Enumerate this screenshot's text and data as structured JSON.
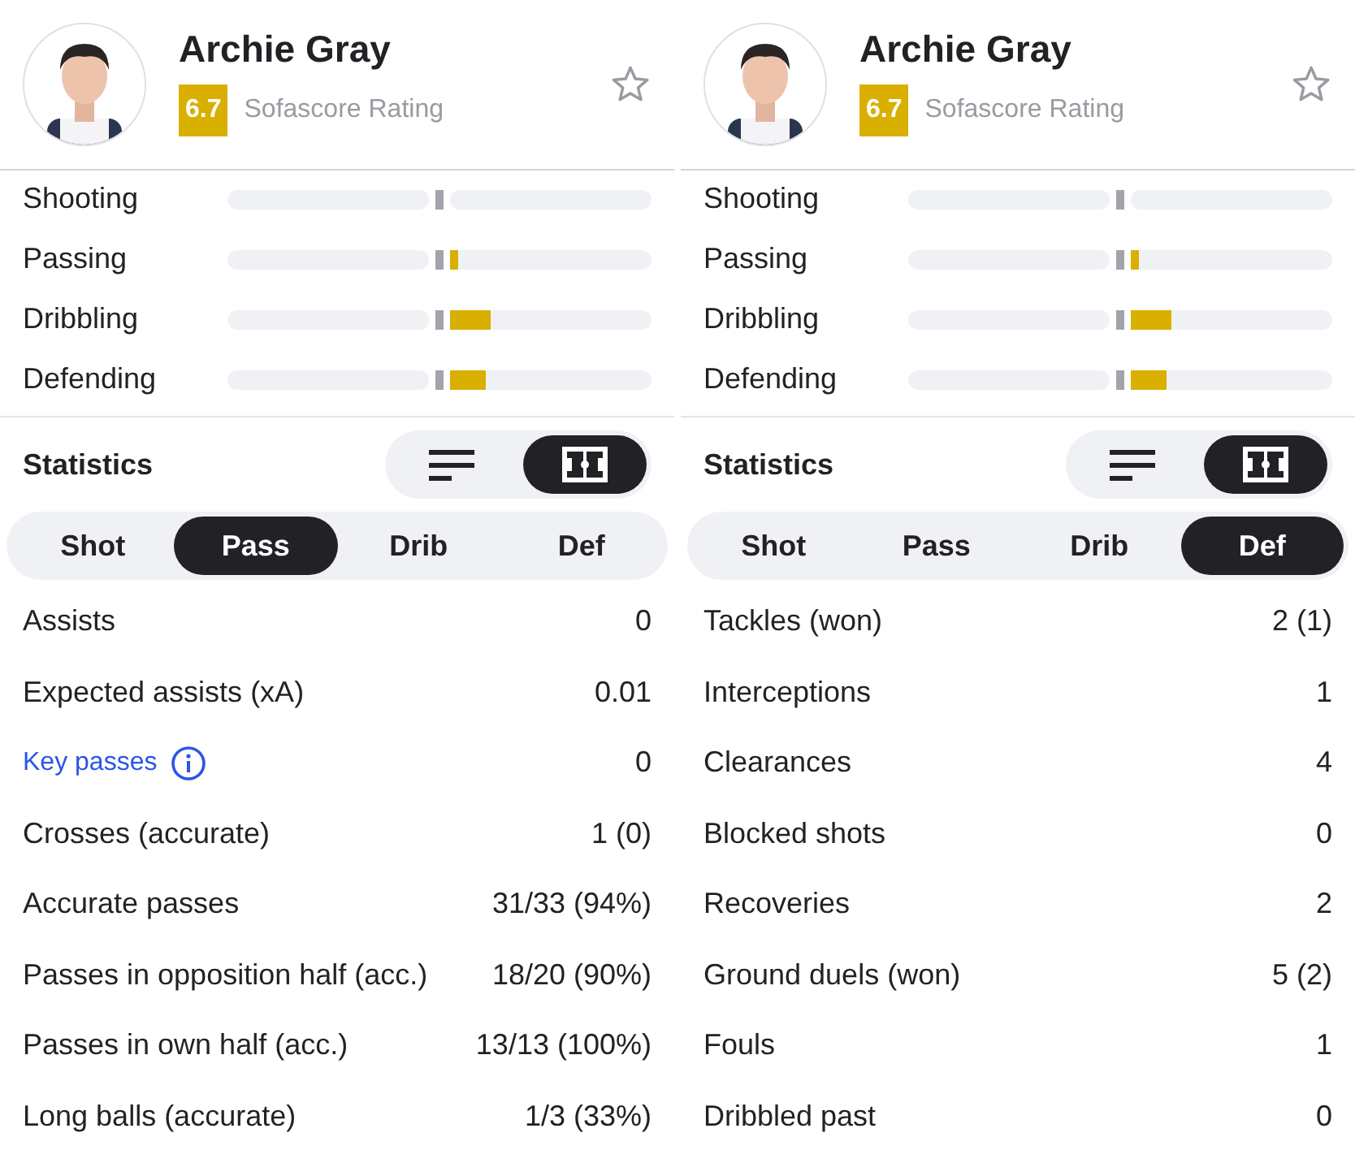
{
  "panels": [
    {
      "player": {
        "name": "Archie Gray",
        "rating": "6.7",
        "rating_label": "Sofascore Rating"
      },
      "attributes": [
        {
          "name": "Shooting"
        },
        {
          "name": "Passing",
          "level": 0.04
        },
        {
          "name": "Dribbling",
          "level": 0.2
        },
        {
          "name": "Defending",
          "level": 0.18
        }
      ],
      "statistics": {
        "title": "Statistics",
        "views": [
          {
            "kind": "list",
            "selected": false
          },
          {
            "kind": "field",
            "selected": true
          }
        ],
        "tabs": [
          {
            "label": "Shot",
            "selected": false
          },
          {
            "label": "Pass",
            "selected": true
          },
          {
            "label": "Drib",
            "selected": false
          },
          {
            "label": "Def",
            "selected": false
          }
        ],
        "rows": [
          {
            "kind": "plain",
            "label": "Assists",
            "value": "0"
          },
          {
            "kind": "plain",
            "label": "Expected assists (xA)",
            "value": "0.01"
          },
          {
            "kind": "link",
            "label": "Key passes",
            "value": "0"
          },
          {
            "kind": "plain",
            "label": "Crosses (accurate)",
            "value": "1 (0)"
          },
          {
            "kind": "plain",
            "label": "Accurate passes",
            "value": "31/33 (94%)"
          },
          {
            "kind": "plain",
            "label": "Passes in opposition half (acc.)",
            "value": "18/20 (90%)"
          },
          {
            "kind": "plain",
            "label": "Passes in own half (acc.)",
            "value": "13/13 (100%)"
          },
          {
            "kind": "plain",
            "label": "Long balls (accurate)",
            "value": "1/3 (33%)"
          }
        ]
      }
    },
    {
      "player": {
        "name": "Archie Gray",
        "rating": "6.7",
        "rating_label": "Sofascore Rating"
      },
      "attributes": [
        {
          "name": "Shooting"
        },
        {
          "name": "Passing",
          "level": 0.04
        },
        {
          "name": "Dribbling",
          "level": 0.2
        },
        {
          "name": "Defending",
          "level": 0.18
        }
      ],
      "statistics": {
        "title": "Statistics",
        "views": [
          {
            "kind": "list",
            "selected": false
          },
          {
            "kind": "field",
            "selected": true
          }
        ],
        "tabs": [
          {
            "label": "Shot",
            "selected": false
          },
          {
            "label": "Pass",
            "selected": false
          },
          {
            "label": "Drib",
            "selected": false
          },
          {
            "label": "Def",
            "selected": true
          }
        ],
        "rows": [
          {
            "kind": "plain",
            "label": "Tackles (won)",
            "value": "2 (1)"
          },
          {
            "kind": "plain",
            "label": "Interceptions",
            "value": "1"
          },
          {
            "kind": "plain",
            "label": "Clearances",
            "value": "4"
          },
          {
            "kind": "plain",
            "label": "Blocked shots",
            "value": "0"
          },
          {
            "kind": "plain",
            "label": "Recoveries",
            "value": "2"
          },
          {
            "kind": "plain",
            "label": "Ground duels (won)",
            "value": "5 (2)"
          },
          {
            "kind": "plain",
            "label": "Fouls",
            "value": "1"
          },
          {
            "kind": "plain",
            "label": "Dribbled past",
            "value": "0"
          }
        ]
      }
    }
  ]
}
